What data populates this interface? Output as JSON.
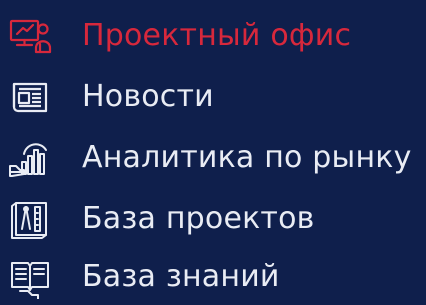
{
  "colors": {
    "background": "#0f1f4c",
    "active": "#d7283c",
    "text": "#e9ecf4"
  },
  "menu": {
    "items": [
      {
        "label": "Проектный офис",
        "icon": "project-office-icon",
        "active": true
      },
      {
        "label": "Новости",
        "icon": "news-icon",
        "active": false
      },
      {
        "label": "Аналитика по рынку",
        "icon": "market-analytics-icon",
        "active": false
      },
      {
        "label": "База проектов",
        "icon": "projects-base-icon",
        "active": false
      },
      {
        "label": "База знаний",
        "icon": "knowledge-base-icon",
        "active": false
      }
    ]
  }
}
